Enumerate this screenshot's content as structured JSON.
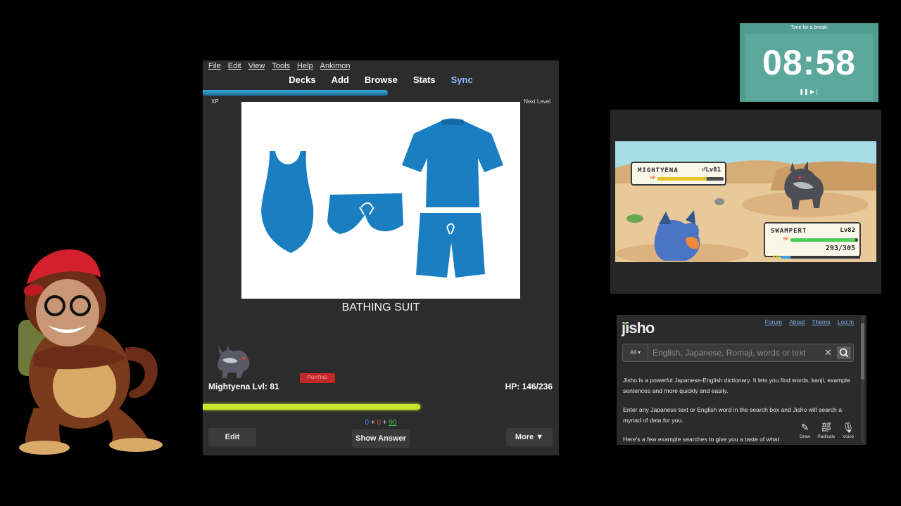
{
  "anki": {
    "menu": [
      "File",
      "Edit",
      "View",
      "Tools",
      "Help",
      "Ankimon"
    ],
    "toolbar": [
      "Decks",
      "Add",
      "Browse",
      "Stats",
      "Sync"
    ],
    "xp_label": "XP",
    "xp_progress": 0.52,
    "next_level_label": "Next Level",
    "card_word": "BATHING SUIT",
    "pokemon_name": "Mightyena Lvl: 81",
    "pokemon_type": "FIGHTING",
    "hp_text": "HP: 146/236",
    "hp_fraction": 0.61,
    "counts": {
      "new": "0",
      "plus1": "+",
      "learn": "0",
      "plus2": "+",
      "review": "90"
    },
    "edit_label": "Edit",
    "show_answer_label": "Show Answer",
    "more_label": "More ▼"
  },
  "timer": {
    "title": "Time for a break!",
    "time": "08:58",
    "controls": "❚❚ ▶❘"
  },
  "battle": {
    "enemy_name": "MIGHTYENA",
    "enemy_level": "♂Lv81",
    "enemy_hp_fraction": 0.74,
    "player_name": "SWAMPERT",
    "player_level": "Lv82",
    "player_hp_numbers": "293/305",
    "player_hp_fraction": 0.96,
    "exp_fraction": 0.12,
    "hp_tag": "HP",
    "exp_tag": "EXP"
  },
  "jisho": {
    "logo": "jisho",
    "nav": [
      "Forum",
      "About",
      "Theme",
      "Log in"
    ],
    "scope": "All ▾",
    "search_placeholder": "English, Japanese, Romaji, words or text",
    "para1": "Jisho is a powerful Japanese-English dictionary. It lets you find words, kanji, example sentences and more quickly and easily.",
    "para2": "Enter any Japanese text or English word in the search box and Jisho will search a myriad of data for you.",
    "para3": "Here's a few example searches to give you a taste of what",
    "tools": [
      {
        "glyph": "✎",
        "label": "Draw"
      },
      {
        "glyph": "部",
        "label": "Radicals"
      },
      {
        "glyph": "🎙",
        "label": "Voice"
      }
    ]
  },
  "colors": {
    "xp_bar": "#2e93c4",
    "hp_bar": "#c8e62a",
    "timer_bg": "#519c91",
    "clothing_blue": "#1a7ec2"
  }
}
